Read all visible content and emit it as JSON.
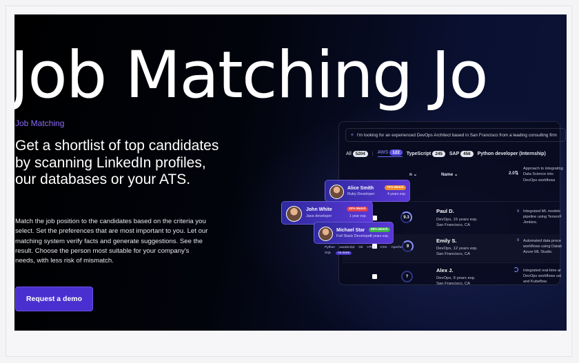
{
  "marquee": "g Job Matching Jo",
  "eyebrow": "Job Matching",
  "headline": "Get a shortlist of top candidates by scanning LinkedIn profiles, our databases or your ATS.",
  "body": "Match the job position to the candidates based on the criteria you select. Set the preferences that are most important to you. Let our matching system verify facts and generate suggestions. See the result. Choose the person most suitable for your company's needs, with less risk of mismatch.",
  "cta_label": "Request a demo",
  "app": {
    "search_text": "I'm looking for an experienced DevOps Architect based in San Francisco from a leading consulting firm",
    "filters": {
      "all_label": "All",
      "all_count": "5204",
      "aws_label": "AWS",
      "aws_count": "122",
      "ts_label": "TypeScript",
      "ts_count": "245",
      "sap_label": "SAP",
      "sap_count": "456",
      "python_label": "Python developer (Internship)"
    },
    "columns": {
      "match": "n",
      "name": "Name",
      "score_head": "2.0",
      "approach": "Approach to integrating Data Science into DevOps workflows"
    },
    "rows": [
      {
        "score": "9.3",
        "name": "Paul D.",
        "sub1": "DevOps, 15 years exp.",
        "sub2": "San Francisco, CA",
        "num": "9",
        "desc1": "Integrated ML models",
        "desc2": "pipeline using TensorF",
        "desc3": "Jenkins."
      },
      {
        "score": "9",
        "name": "Emily S.",
        "sub1": "DevOps, 12 years exp.",
        "sub2": "San Francisco, CA",
        "num": "9",
        "desc1": "Automated data proce",
        "desc2": "workflows using Datab",
        "desc3": "Azure ML Studio."
      },
      {
        "score": "?",
        "name": "Alex J.",
        "sub1": "DevOps, 9 years exp.",
        "sub2": "San Francisco, CA",
        "num": "",
        "desc1": "Integrated real-time ar",
        "desc2": "DevOps workflows usi",
        "desc3": "and Kubeflow."
      }
    ]
  },
  "cards": [
    {
      "name": "Alice Smith",
      "role": "Ruby Developer",
      "match": "75% Match",
      "exp": "4 years exp.",
      "badge_color": "#f08a2c"
    },
    {
      "name": "John White",
      "role": "Java developer",
      "match": "43% Match",
      "exp": "1 year exp.",
      "badge_color": "#e0424a"
    },
    {
      "name": "Michael Star",
      "role": "Full Stack Developer",
      "match": "95% Match",
      "exp": "5 years exp.",
      "badge_color": "#3fb24a"
    }
  ],
  "skills": [
    "Python",
    "JavaScript",
    "Git",
    "HTML",
    "CSS",
    "Apache",
    "SQL",
    "+5 more"
  ]
}
